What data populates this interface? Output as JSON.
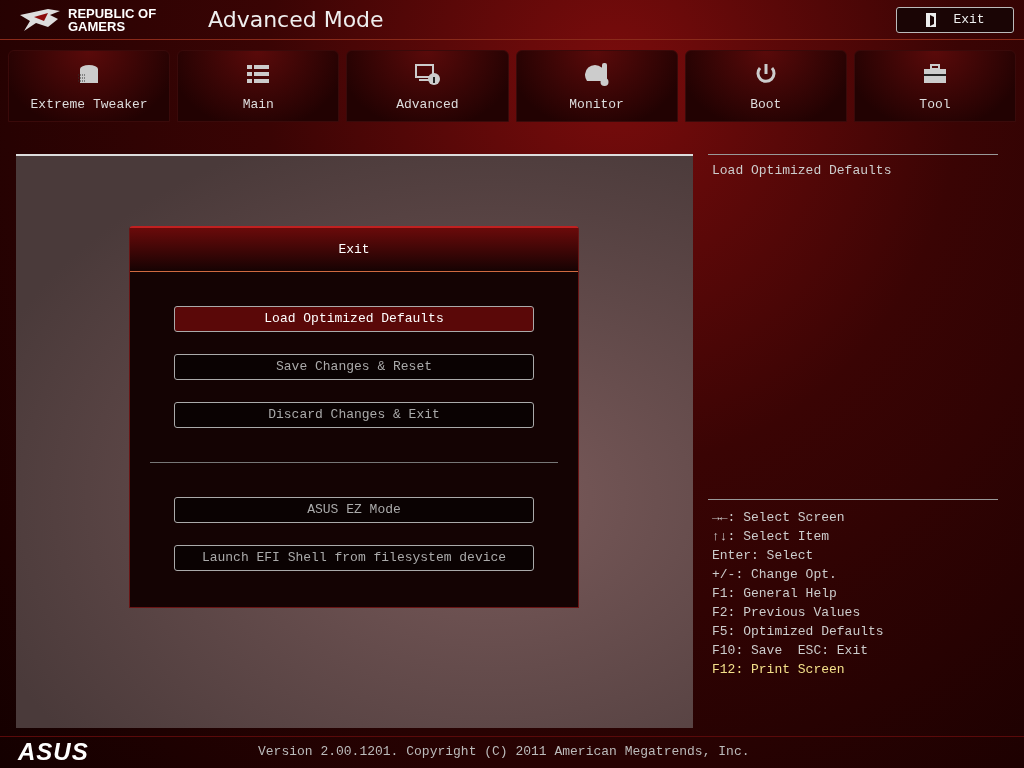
{
  "header": {
    "brand": "REPUBLIC OF GAMERS",
    "title": "Advanced Mode",
    "exit_button": "Exit"
  },
  "tabs": [
    {
      "label": "Extreme Tweaker",
      "selected": false
    },
    {
      "label": "Main",
      "selected": false
    },
    {
      "label": "Advanced",
      "selected": false
    },
    {
      "label": "Monitor",
      "selected": false
    },
    {
      "label": "Boot",
      "selected": false
    },
    {
      "label": "Tool",
      "selected": false
    }
  ],
  "dialog": {
    "title": "Exit",
    "button_groups": [
      [
        {
          "label": "Load Optimized Defaults",
          "selected": true
        },
        {
          "label": "Save Changes & Reset",
          "selected": false
        },
        {
          "label": "Discard Changes & Exit",
          "selected": false
        }
      ],
      [
        {
          "label": "ASUS EZ Mode",
          "selected": false
        },
        {
          "label": "Launch EFI Shell from filesystem device",
          "selected": false
        }
      ]
    ]
  },
  "help": {
    "description": "Load Optimized Defaults",
    "keys": [
      {
        "text": "→←: Select Screen",
        "highlighted": false
      },
      {
        "text": "↑↓: Select Item",
        "highlighted": false
      },
      {
        "text": "Enter: Select",
        "highlighted": false
      },
      {
        "text": "+/-: Change Opt.",
        "highlighted": false
      },
      {
        "text": "F1: General Help",
        "highlighted": false
      },
      {
        "text": "F2: Previous Values",
        "highlighted": false
      },
      {
        "text": "F5: Optimized Defaults",
        "highlighted": false
      },
      {
        "text": "F10: Save  ESC: Exit",
        "highlighted": false
      },
      {
        "text": "F12: Print Screen",
        "highlighted": true
      }
    ]
  },
  "footer": {
    "logo": "ASUS",
    "version": "Version 2.00.1201. Copyright (C) 2011 American Megatrends, Inc."
  }
}
